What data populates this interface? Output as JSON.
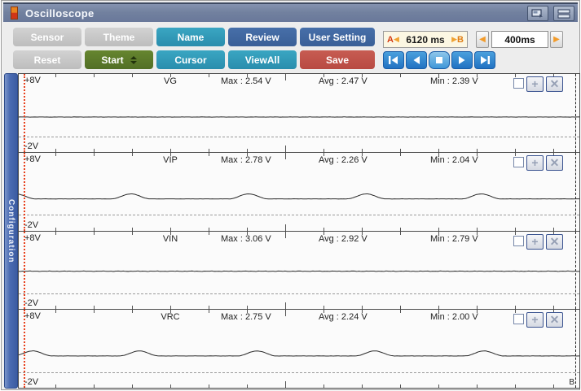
{
  "window": {
    "title": "Oscilloscope"
  },
  "toolbar": {
    "buttons": {
      "sensor": "Sensor",
      "theme": "Theme",
      "name": "Name",
      "review": "Review",
      "user_setting": "User Setting",
      "reset": "Reset",
      "start": "Start",
      "cursor": "Cursor",
      "viewall": "ViewAll",
      "save": "Save"
    }
  },
  "time_controls": {
    "a_label": "A",
    "b_label": "B",
    "ab_value": "6120 ms",
    "timebase_value": "400ms"
  },
  "icons": {
    "left_triangle": "◀",
    "right_triangle": "▶",
    "plus": "+",
    "close": "✕"
  },
  "sidebar": {
    "label": "Configuration"
  },
  "cursors": {
    "b_label": "B"
  },
  "colors": {
    "teal": "#2f9bb7",
    "blue": "#3c6ca8",
    "green": "#5b7c2a",
    "red": "#c0504a",
    "orange": "#f0a232",
    "titlebar": "#72819f"
  },
  "channels": [
    {
      "name": "VG",
      "y_top": "+8V",
      "y_bottom": "-2V",
      "max_label": "Max : 2.54 V",
      "avg_label": "Avg : 2.47 V",
      "min_label": "Min : 2.39 V",
      "wave": {
        "base_v": 2.47,
        "peak_v": 2.47,
        "pulse_centers": [],
        "pulse_halfwidth": 0.03,
        "noise_v": 0.022
      }
    },
    {
      "name": "VIP",
      "y_top": "+8V",
      "y_bottom": "-2V",
      "max_label": "Max : 2.78 V",
      "avg_label": "Avg : 2.26 V",
      "min_label": "Min : 2.04 V",
      "wave": {
        "base_v": 2.08,
        "peak_v": 2.72,
        "pulse_centers": [
          -0.005,
          0.2,
          0.41,
          0.62,
          0.825
        ],
        "pulse_halfwidth": 0.035,
        "noise_v": 0.015
      }
    },
    {
      "name": "VIN",
      "y_top": "+8V",
      "y_bottom": "-2V",
      "max_label": "Max : 3.06 V",
      "avg_label": "Avg : 2.92 V",
      "min_label": "Min : 2.79 V",
      "wave": {
        "base_v": 2.92,
        "peak_v": 2.92,
        "pulse_centers": [],
        "pulse_halfwidth": 0.03,
        "noise_v": 0.04
      }
    },
    {
      "name": "VRC",
      "y_top": "+8V",
      "y_bottom": "-2V",
      "max_label": "Max : 2.75 V",
      "avg_label": "Avg : 2.24 V",
      "min_label": "Min : 2.00 V",
      "wave": {
        "base_v": 2.06,
        "peak_v": 2.7,
        "pulse_centers": [
          0.025,
          0.215,
          0.425,
          0.635,
          0.83
        ],
        "pulse_halfwidth": 0.035,
        "noise_v": 0.018
      }
    }
  ]
}
